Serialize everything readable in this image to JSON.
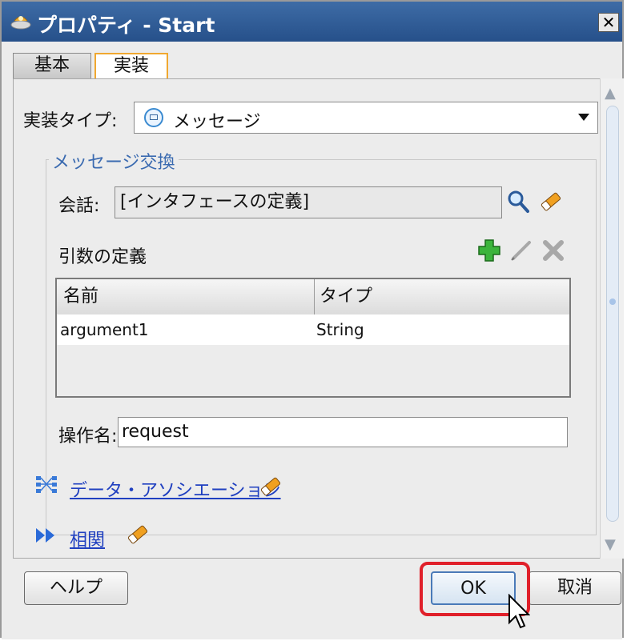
{
  "window": {
    "title": "プロパティ - Start",
    "close_label": "✕"
  },
  "tabs": [
    {
      "label": "基本",
      "active": false
    },
    {
      "label": "実装",
      "active": true
    }
  ],
  "implementation": {
    "label": "実装タイプ:",
    "selected": "メッセージ",
    "icon": "envelope-icon"
  },
  "message_exchange": {
    "group_title": "メッセージ交換",
    "conversation_label": "会話:",
    "conversation_value": "[インタフェースの定義]",
    "arguments_label": "引数の定義",
    "table": {
      "columns": [
        "名前",
        "タイプ"
      ],
      "rows": [
        {
          "name": "argument1",
          "type": "String"
        }
      ]
    },
    "operation_label": "操作名:",
    "operation_value": "request"
  },
  "links": {
    "data_association": "データ・アソシエーション",
    "correlation": "相関"
  },
  "buttons": {
    "help": "ヘルプ",
    "ok": "OK",
    "cancel": "取消"
  },
  "colors": {
    "titlebar": "#26508a",
    "link": "#2040c0",
    "highlight": "#e0202a",
    "active_tab_border": "#f0a830"
  }
}
